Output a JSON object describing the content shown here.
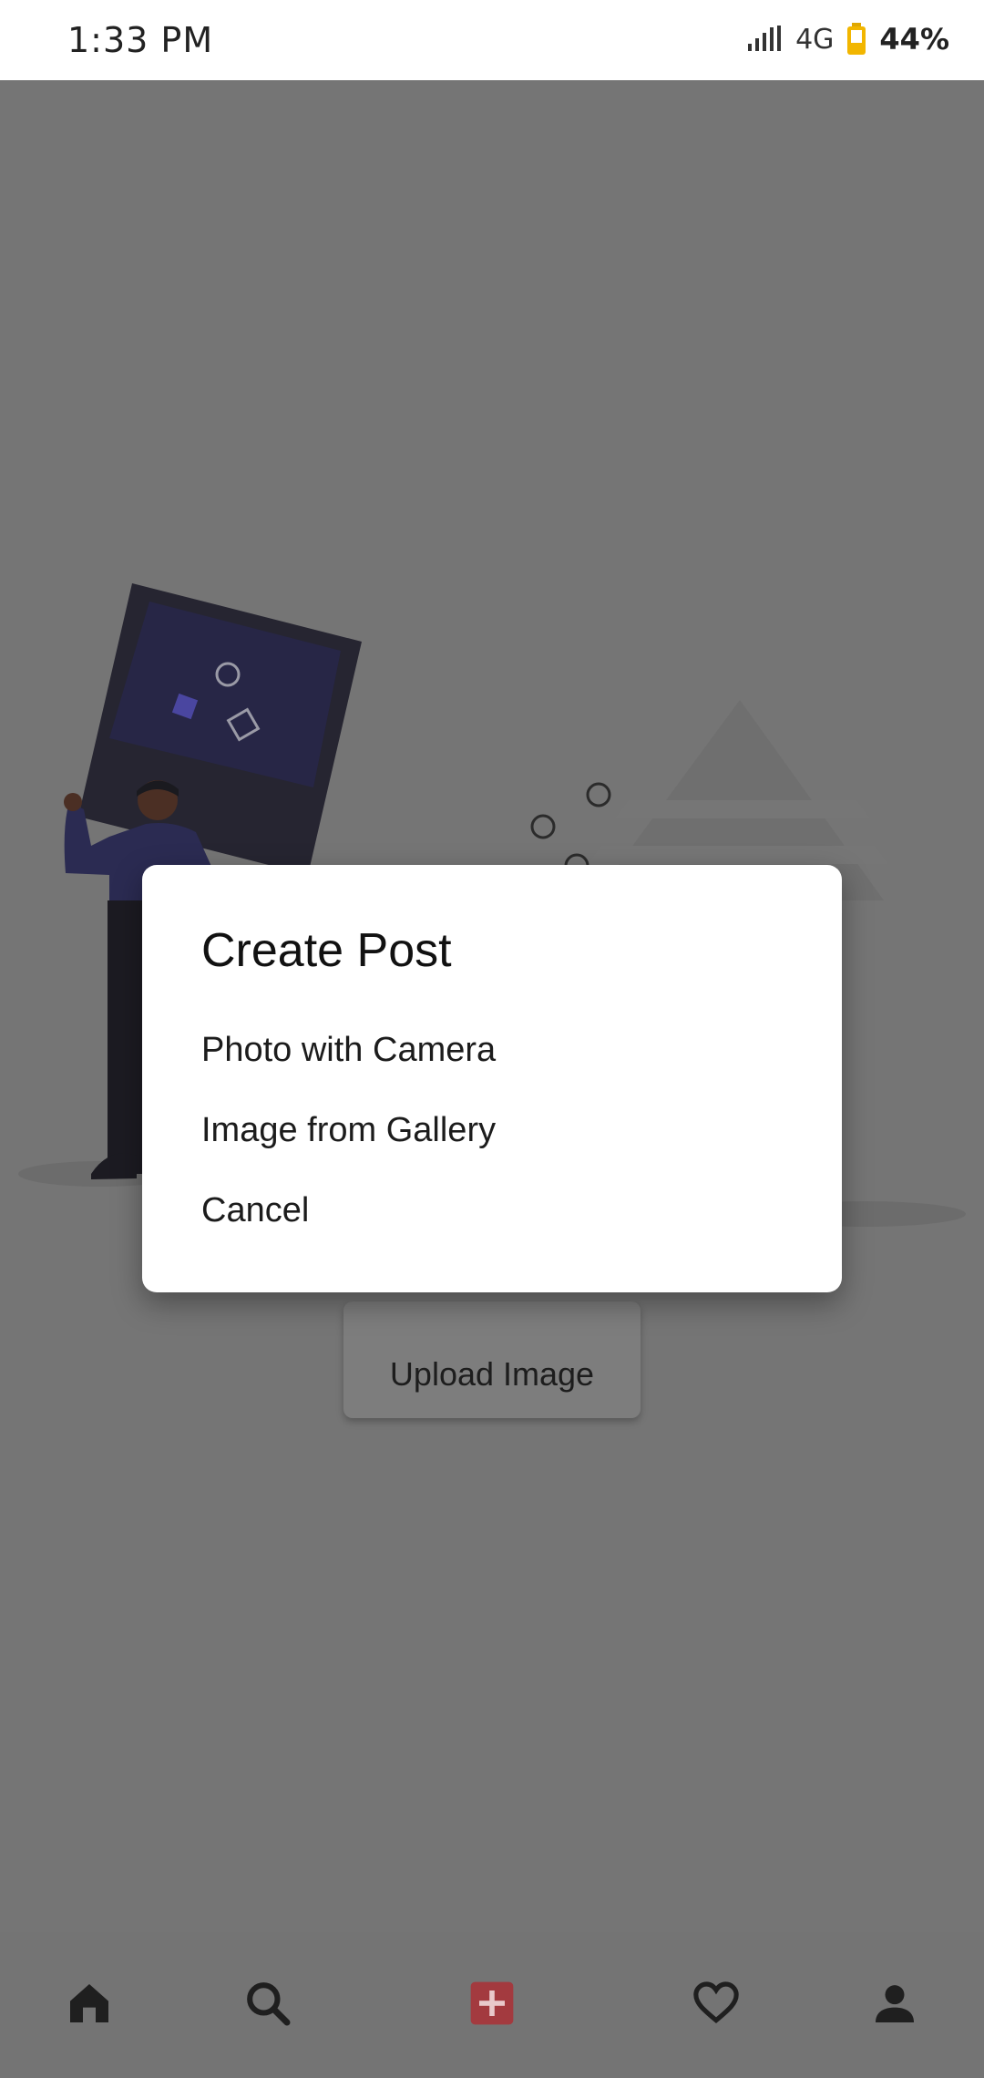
{
  "status_bar": {
    "time": "1:33 PM",
    "network": "4G",
    "battery_percent": "44%",
    "icons": [
      "signal-icon",
      "battery-icon"
    ]
  },
  "main": {
    "upload_button_label": "Upload Image"
  },
  "dialog": {
    "title": "Create Post",
    "options": [
      {
        "label": "Photo with Camera"
      },
      {
        "label": "Image from Gallery"
      },
      {
        "label": "Cancel"
      }
    ]
  },
  "bottom_nav": {
    "items": [
      {
        "icon": "home-icon"
      },
      {
        "icon": "search-icon"
      },
      {
        "icon": "add-post-icon"
      },
      {
        "icon": "heart-icon"
      },
      {
        "icon": "profile-icon"
      }
    ],
    "accent_color": "#a33a3f"
  },
  "colors": {
    "scrim": "#757575",
    "dialog_bg": "#ffffff"
  }
}
